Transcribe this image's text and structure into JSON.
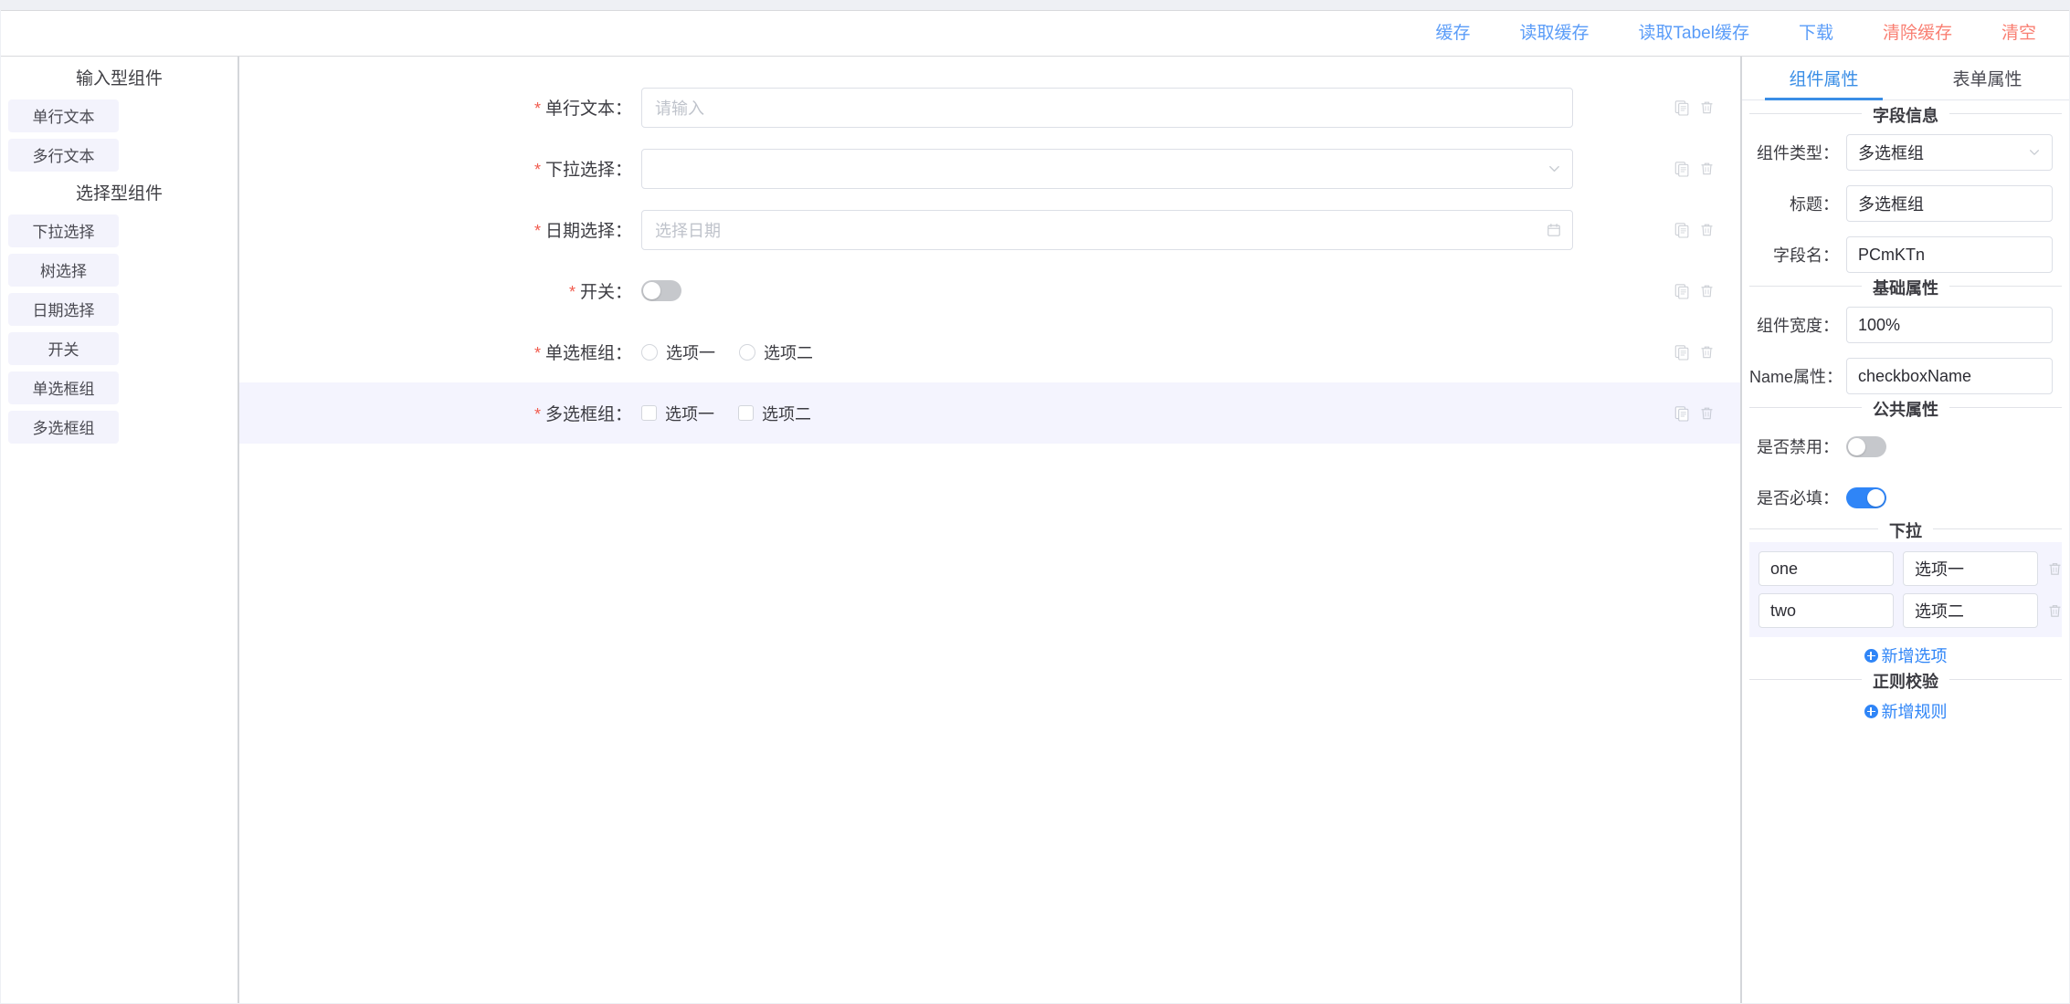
{
  "toolbar": {
    "buttons": [
      {
        "label": "缓存",
        "kind": "primary"
      },
      {
        "label": "读取缓存",
        "kind": "primary"
      },
      {
        "label": "读取Tabel缓存",
        "kind": "primary"
      },
      {
        "label": "下载",
        "kind": "primary"
      },
      {
        "label": "清除缓存",
        "kind": "danger"
      },
      {
        "label": "清空",
        "kind": "danger"
      }
    ]
  },
  "palette": {
    "groups": [
      {
        "title": "输入型组件",
        "items": [
          {
            "label": "单行文本"
          },
          {
            "label": "多行文本"
          }
        ]
      },
      {
        "title": "选择型组件",
        "items": [
          {
            "label": "下拉选择"
          },
          {
            "label": "树选择"
          },
          {
            "label": "日期选择"
          },
          {
            "label": "开关"
          },
          {
            "label": "单选框组"
          },
          {
            "label": "多选框组"
          }
        ]
      }
    ]
  },
  "canvas": {
    "rows": [
      {
        "label": "单行文本",
        "required": true,
        "type": "input",
        "value": "",
        "placeholder": "请输入",
        "selected": false
      },
      {
        "label": "下拉选择",
        "required": true,
        "type": "select",
        "value": "",
        "placeholder": "",
        "selected": false
      },
      {
        "label": "日期选择",
        "required": true,
        "type": "date",
        "value": "",
        "placeholder": "选择日期",
        "selected": false
      },
      {
        "label": "开关",
        "required": true,
        "type": "switch",
        "on": false,
        "selected": false
      },
      {
        "label": "单选框组",
        "required": true,
        "type": "radio-group",
        "options": [
          "选项一",
          "选项二"
        ],
        "selected": false
      },
      {
        "label": "多选框组",
        "required": true,
        "type": "checkbox-group",
        "options": [
          "选项一",
          "选项二"
        ],
        "selected": true
      }
    ],
    "row_action_icons": [
      "copy-icon",
      "trash-icon"
    ]
  },
  "props": {
    "tabs": [
      {
        "label": "组件属性",
        "active": true
      },
      {
        "label": "表单属性",
        "active": false
      }
    ],
    "field_info": {
      "legend": "字段信息",
      "component_type_label": "组件类型：",
      "component_type_value": "多选框组",
      "title_label": "标题：",
      "title_value": "多选框组",
      "field_name_label": "字段名：",
      "field_name_value": "PCmKTn"
    },
    "base_attrs": {
      "legend": "基础属性",
      "width_label": "组件宽度：",
      "width_value": "100%",
      "name_label": "Name属性：",
      "name_value": "checkboxName"
    },
    "common_attrs": {
      "legend": "公共属性",
      "disabled_label": "是否禁用：",
      "disabled_on": false,
      "required_label": "是否必填：",
      "required_on": true
    },
    "dropdown": {
      "legend": "下拉",
      "options": [
        {
          "key": "one",
          "text": "选项一"
        },
        {
          "key": "two",
          "text": "选项二"
        }
      ],
      "add_label": "新增选项"
    },
    "regex": {
      "legend": "正则校验",
      "add_label": "新增规则"
    }
  },
  "colors": {
    "primary": "#2f85f7",
    "link": "#5a9cf8",
    "danger": "#f97f72",
    "required_star": "#f15b4e",
    "selected_row_bg": "#f4f4fe",
    "palette_item_bg": "#f3f3fc"
  }
}
